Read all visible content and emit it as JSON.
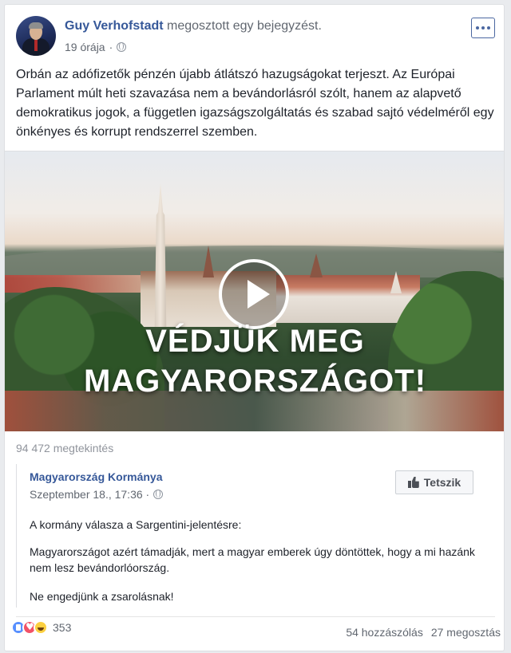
{
  "post": {
    "author": "Guy Verhofstadt",
    "action": "megosztott egy bejegyzést.",
    "time": "19 órája",
    "privacy_icon": "globe-icon",
    "text": "Orbán az adófizetők pénzén újabb átlátszó hazugságokat terjeszt. Az Európai Parlament múlt heti szavazása nem a bevándorlásról szólt, hanem az alapvető demokratikus jogok, a független igazságszolgáltatás és szabad sajtó védelméről egy önkényes és korrupt rendszerrel szemben."
  },
  "video": {
    "title_line1": "VÉDJÜK MEG",
    "title_line2": "MAGYARORSZÁGOT!",
    "views": "94 472 megtekintés"
  },
  "shared": {
    "page_name": "Magyarország Kormánya",
    "time": "Szeptember 18., 17:36 ·",
    "like_label": "Tetszik",
    "text1": "A kormány válasza a Sargentini-jelentésre:",
    "text2": "Magyarországot azért támadják, mert a magyar emberek úgy döntöttek, hogy a mi hazánk nem lesz bevándorlóország.",
    "text3": "Ne engedjünk a zsarolásnak!"
  },
  "footer": {
    "reaction_count": "353",
    "comments": "54 hozzászólás",
    "shares": "27 megosztás"
  },
  "colors": {
    "link": "#365899",
    "muted": "#616770",
    "background": "#e9ebee"
  }
}
